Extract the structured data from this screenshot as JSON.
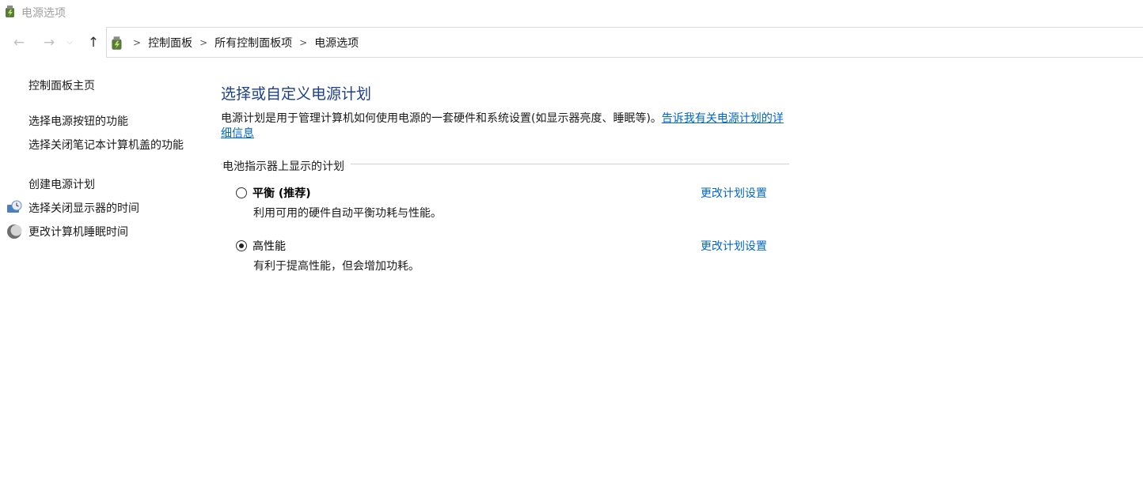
{
  "window": {
    "title": "电源选项"
  },
  "nav": {
    "back_icon": "back-arrow-icon",
    "forward_icon": "forward-arrow-icon",
    "recent_icon": "chevron-down-icon",
    "up_icon": "up-arrow-icon"
  },
  "address": {
    "crumbs": [
      "控制面板",
      "所有控制面板项",
      "电源选项"
    ]
  },
  "sidebar": {
    "home": "控制面板主页",
    "items": [
      {
        "label": "选择电源按钮的功能"
      },
      {
        "label": "选择关闭笔记本计算机盖的功能"
      },
      {
        "label": "创建电源计划"
      },
      {
        "label": "选择关闭显示器的时间",
        "icon": "monitor-clock-icon"
      },
      {
        "label": "更改计算机睡眠时间",
        "icon": "moon-sleep-icon"
      }
    ]
  },
  "main": {
    "title": "选择或自定义电源计划",
    "description": "电源计划是用于管理计算机如何使用电源的一套硬件和系统设置(如显示器亮度、睡眠等)。",
    "description_link": "告诉我有关电源计划的详细信息",
    "group_label": "电池指示器上显示的计划",
    "plans": [
      {
        "name": "平衡 (推荐)",
        "desc": "利用可用的硬件自动平衡功耗与性能。",
        "link": "更改计划设置",
        "selected": false
      },
      {
        "name": "高性能",
        "desc": "有利于提高性能，但会增加功耗。",
        "link": "更改计划设置",
        "selected": true
      }
    ]
  },
  "colors": {
    "title_blue": "#1e3f8a",
    "link_blue": "#0066cc"
  }
}
